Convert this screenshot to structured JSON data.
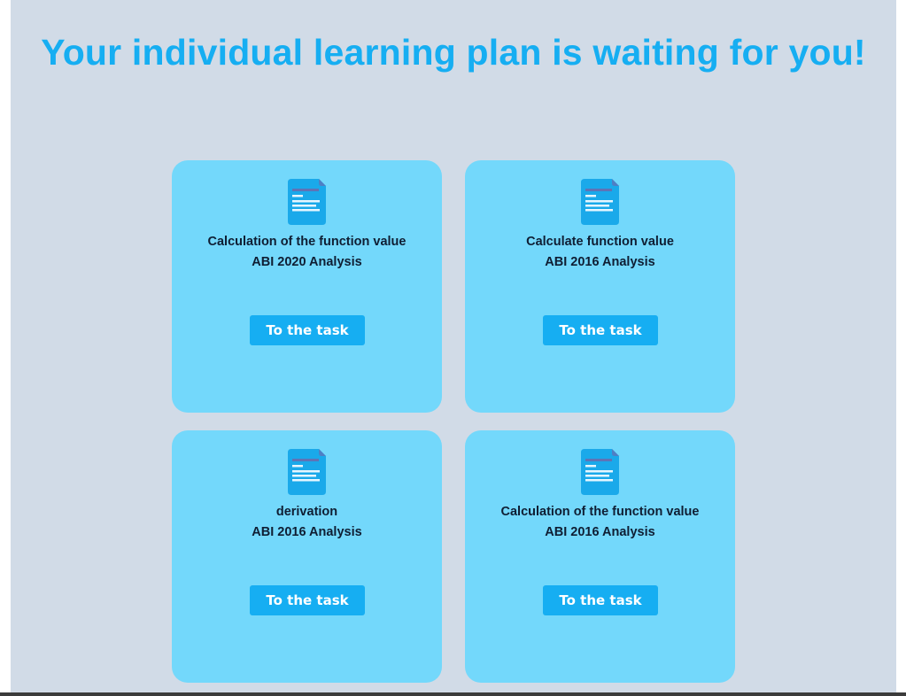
{
  "header": {
    "title": "Your individual learning plan is waiting for you!"
  },
  "colors": {
    "background": "#d1dbe7",
    "accent": "#16aef2",
    "card": "#73d8fb",
    "text": "#0f1e33"
  },
  "cards": [
    {
      "icon": "document-icon",
      "title": "Calculation of the function value",
      "subtitle": "ABI 2020 Analysis",
      "button_label": "To the task"
    },
    {
      "icon": "document-icon",
      "title": "Calculate function value",
      "subtitle": "ABI 2016 Analysis",
      "button_label": "To the task"
    },
    {
      "icon": "document-icon",
      "title": "derivation",
      "subtitle": "ABI 2016 Analysis",
      "button_label": "To the task"
    },
    {
      "icon": "document-icon",
      "title": "Calculation of the function value",
      "subtitle": "ABI 2016 Analysis",
      "button_label": "To the task"
    }
  ]
}
